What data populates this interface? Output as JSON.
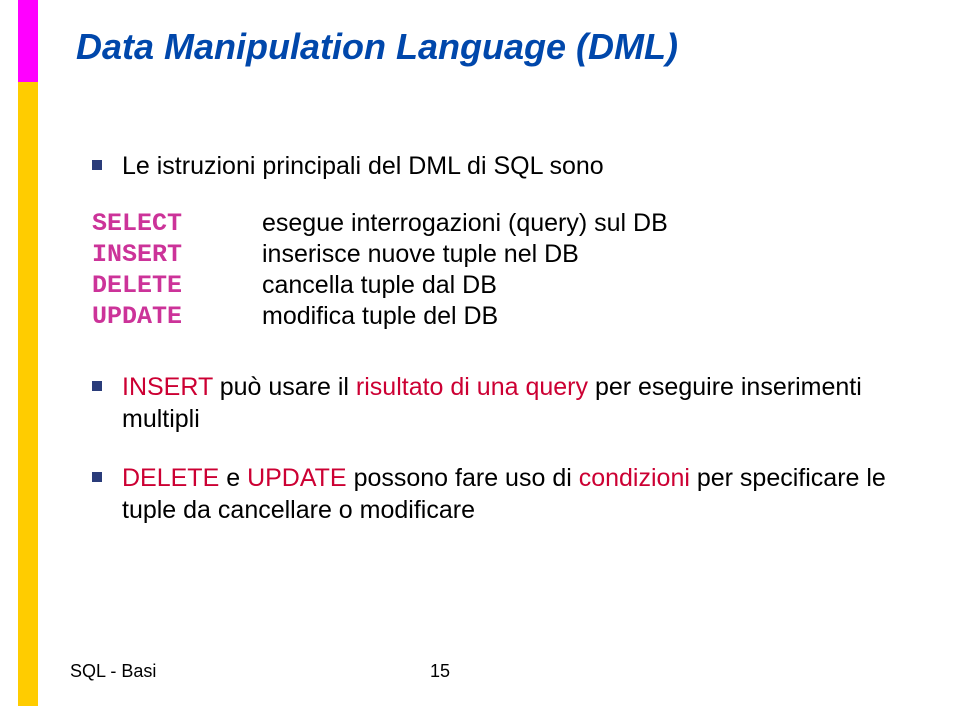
{
  "title": "Data Manipulation Language (DML)",
  "intro_bullet": "Le istruzioni principali del DML di SQL sono",
  "definitions": [
    {
      "keyword": "SELECT",
      "kwclass": "kw-select",
      "desc": "esegue interrogazioni (query) sul DB"
    },
    {
      "keyword": "INSERT",
      "kwclass": "kw-insert",
      "desc": "inserisce nuove tuple nel DB"
    },
    {
      "keyword": "DELETE",
      "kwclass": "kw-delete",
      "desc": "cancella tuple dal DB"
    },
    {
      "keyword": "UPDATE",
      "kwclass": "kw-update",
      "desc": "modifica tuple del DB"
    }
  ],
  "bullets": [
    {
      "parts": [
        {
          "text": "INSERT ",
          "red": true
        },
        {
          "text": "può usare il ",
          "red": false
        },
        {
          "text": "risultato di una query ",
          "red": true
        },
        {
          "text": "per eseguire inserimenti multipli",
          "red": false
        }
      ]
    },
    {
      "parts": [
        {
          "text": "DELETE",
          "red": true
        },
        {
          "text": " e ",
          "red": false
        },
        {
          "text": "UPDATE",
          "red": true
        },
        {
          "text": " possono fare uso di ",
          "red": false
        },
        {
          "text": "condizioni",
          "red": true
        },
        {
          "text": " per specificare le tuple da cancellare o modificare",
          "red": false
        }
      ]
    }
  ],
  "footer": {
    "label": "SQL - Basi",
    "page": "15"
  }
}
